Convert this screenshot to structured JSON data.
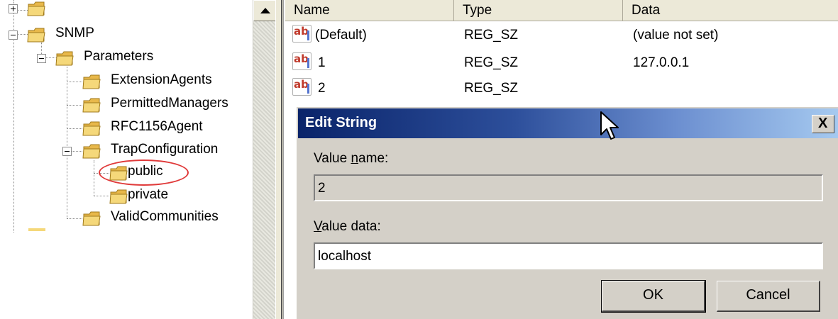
{
  "tree": {
    "items": [
      {
        "label": "SNMP"
      },
      {
        "label": "Parameters"
      },
      {
        "label": "ExtensionAgents"
      },
      {
        "label": "PermittedManagers"
      },
      {
        "label": "RFC1156Agent"
      },
      {
        "label": "TrapConfiguration"
      },
      {
        "label": "public",
        "highlighted": true
      },
      {
        "label": "private"
      },
      {
        "label": "ValidCommunities"
      }
    ],
    "highlight_color": "#e03a3a"
  },
  "list": {
    "columns": [
      "Name",
      "Type",
      "Data"
    ],
    "rows": [
      {
        "name": "(Default)",
        "type": "REG_SZ",
        "data": "(value not set)",
        "icon": "string-value-icon"
      },
      {
        "name": "1",
        "type": "REG_SZ",
        "data": "127.0.0.1",
        "icon": "string-value-icon"
      },
      {
        "name": "2",
        "type": "REG_SZ",
        "data": "",
        "icon": "string-value-icon"
      }
    ]
  },
  "dialog": {
    "title": "Edit String",
    "close_label": "X",
    "value_name_label_pre": "Value ",
    "value_name_label_accel": "n",
    "value_name_label_post": "ame:",
    "value_name": "2",
    "value_data_label_accel": "V",
    "value_data_label_post": "alue data:",
    "value_data": "localhost",
    "ok_label": "OK",
    "cancel_label": "Cancel",
    "titlebar_colors": [
      "#0a246a",
      "#a6caf0"
    ]
  }
}
